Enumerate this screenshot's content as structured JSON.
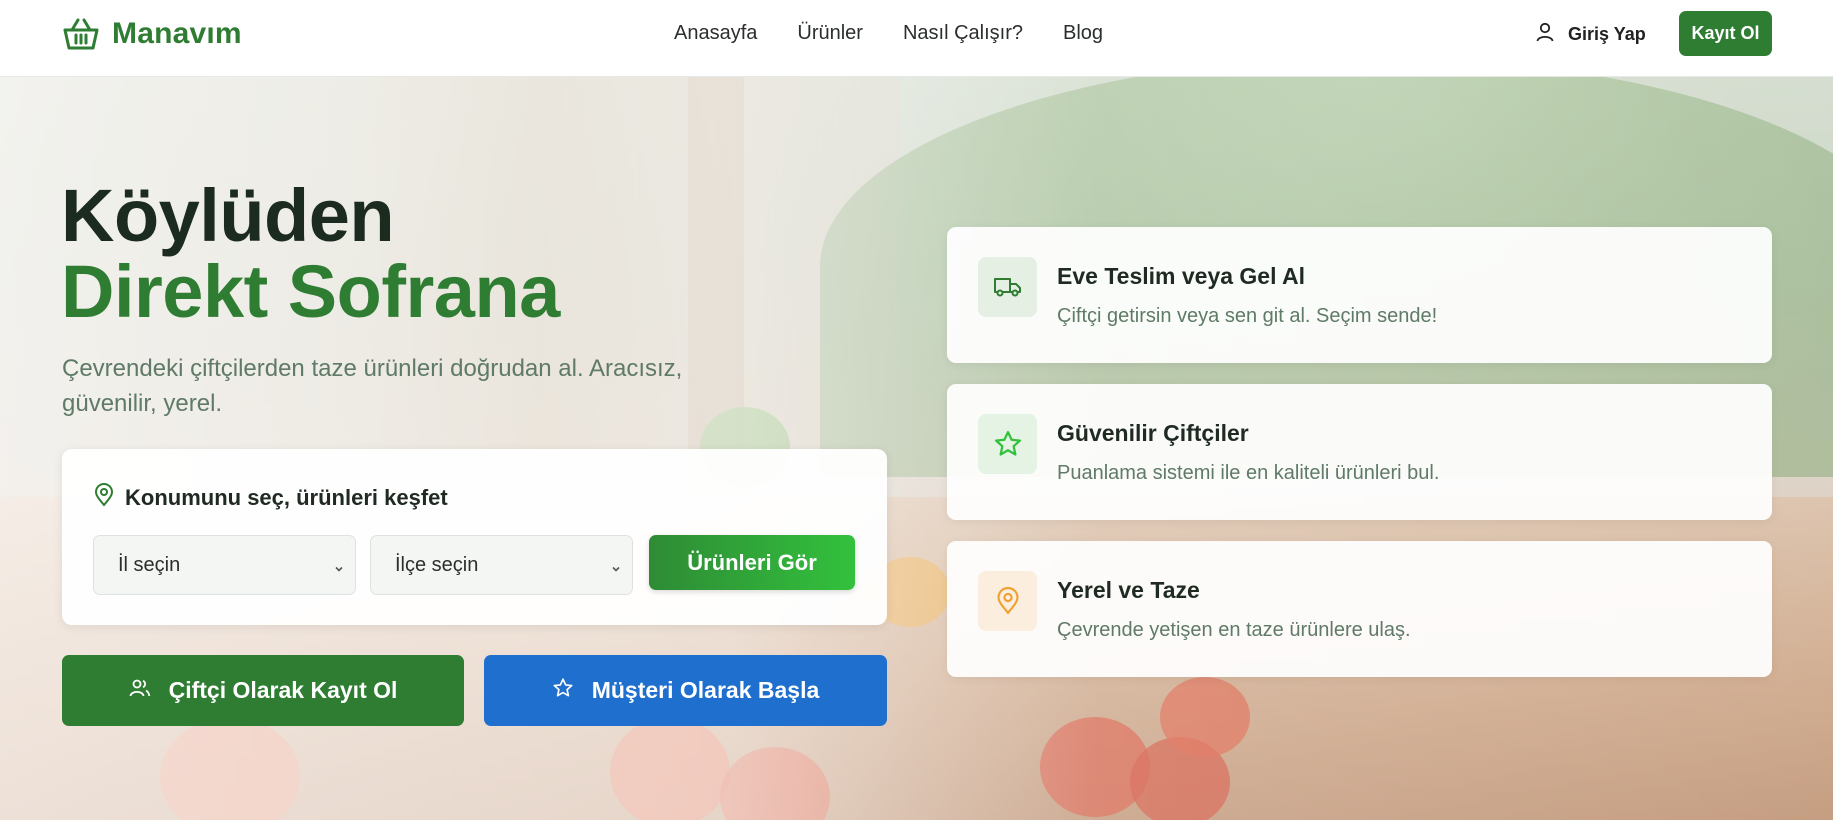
{
  "brand": {
    "name": "Manavım",
    "color": "#2e7d32"
  },
  "nav": {
    "items": [
      {
        "label": "Anasayfa"
      },
      {
        "label": "Ürünler"
      },
      {
        "label": "Nasıl Çalışır?"
      },
      {
        "label": "Blog"
      }
    ],
    "login_label": "Giriş Yap",
    "signup_label": "Kayıt Ol"
  },
  "hero": {
    "title_line1": "Köylüden",
    "title_line2": "Direkt Sofrana",
    "subtitle": "Çevrendeki çiftçilerden taze ürünleri doğrudan al. Aracısız, güvenilir, yerel."
  },
  "location": {
    "title": "Konumunu seç, ürünleri keşfet",
    "province_select": "İl seçin",
    "district_select": "İlçe seçin",
    "button_label": "Ürünleri Gör"
  },
  "cta": {
    "farmer_label": "Çiftçi Olarak Kayıt Ol",
    "customer_label": "Müşteri Olarak Başla"
  },
  "features": [
    {
      "icon": "truck-icon",
      "title": "Eve Teslim veya Gel Al",
      "desc": "Çiftçi getirsin veya sen git al. Seçim sende!",
      "accent": "#2e7d32"
    },
    {
      "icon": "star-icon",
      "title": "Güvenilir Çiftçiler",
      "desc": "Puanlama sistemi ile en kaliteli ürünleri bul.",
      "accent": "#33c13d"
    },
    {
      "icon": "map-pin-icon",
      "title": "Yerel ve Taze",
      "desc": "Çevrende yetişen en taze ürünlere ulaş.",
      "accent": "#f0a030"
    }
  ],
  "colors": {
    "primary_green": "#2e7d32",
    "customer_blue": "#1f6fcf"
  }
}
